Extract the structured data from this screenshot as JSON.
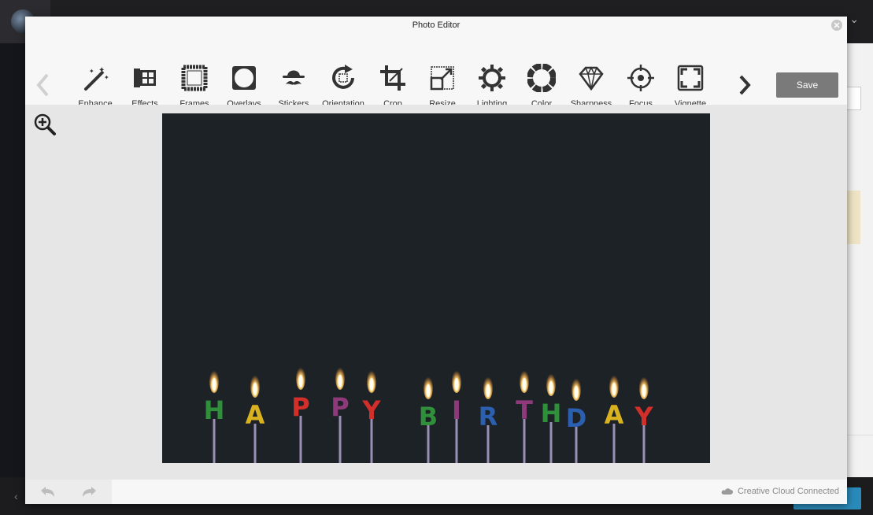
{
  "window": {
    "title": "Photo Editor"
  },
  "toolbar": {
    "tools": [
      {
        "label": "Enhance",
        "icon": "magic-wand-icon"
      },
      {
        "label": "Effects",
        "icon": "film-strip-icon"
      },
      {
        "label": "Frames",
        "icon": "frame-icon"
      },
      {
        "label": "Overlays",
        "icon": "overlay-icon"
      },
      {
        "label": "Stickers",
        "icon": "hat-mustache-icon"
      },
      {
        "label": "Orientation",
        "icon": "rotate-icon"
      },
      {
        "label": "Crop",
        "icon": "crop-icon"
      },
      {
        "label": "Resize",
        "icon": "resize-icon"
      },
      {
        "label": "Lighting",
        "icon": "sun-icon"
      },
      {
        "label": "Color",
        "icon": "color-wheel-icon"
      },
      {
        "label": "Sharpness",
        "icon": "diamond-icon"
      },
      {
        "label": "Focus",
        "icon": "crosshair-icon"
      },
      {
        "label": "Vignette",
        "icon": "vignette-icon"
      }
    ],
    "save_label": "Save"
  },
  "photo": {
    "candles": [
      {
        "letter": "H",
        "color": "#2f8f3a"
      },
      {
        "letter": "A",
        "color": "#d8b21f"
      },
      {
        "letter": "P",
        "color": "#d22f2a"
      },
      {
        "letter": "P",
        "color": "#8e3a7a"
      },
      {
        "letter": "Y",
        "color": "#d22f2a"
      },
      {
        "letter": "B",
        "color": "#2f8f3a"
      },
      {
        "letter": "I",
        "color": "#8e3a7a"
      },
      {
        "letter": "R",
        "color": "#2b5fb0"
      },
      {
        "letter": "T",
        "color": "#8e3a7a"
      },
      {
        "letter": "H",
        "color": "#2f8f3a"
      },
      {
        "letter": "D",
        "color": "#2b5fb0"
      },
      {
        "letter": "A",
        "color": "#d8b21f"
      },
      {
        "letter": "Y",
        "color": "#d22f2a"
      }
    ]
  },
  "footer": {
    "cc_status": "Creative Cloud Connected"
  },
  "colors": {
    "save_bg": "#7a7a7a",
    "photo_bg": "#1c2226"
  }
}
